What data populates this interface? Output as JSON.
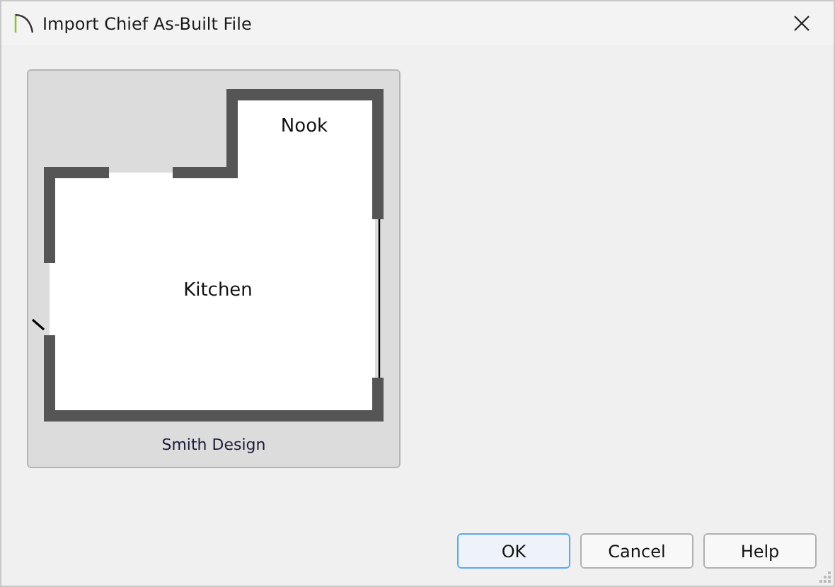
{
  "window": {
    "title": "Import Chief As-Built File"
  },
  "preview": {
    "rooms": [
      {
        "name": "Nook"
      },
      {
        "name": "Kitchen"
      }
    ],
    "caption": "Smith Design"
  },
  "buttons": [
    {
      "label": "OK",
      "default": true
    },
    {
      "label": "Cancel",
      "default": false
    },
    {
      "label": "Help",
      "default": false
    }
  ]
}
